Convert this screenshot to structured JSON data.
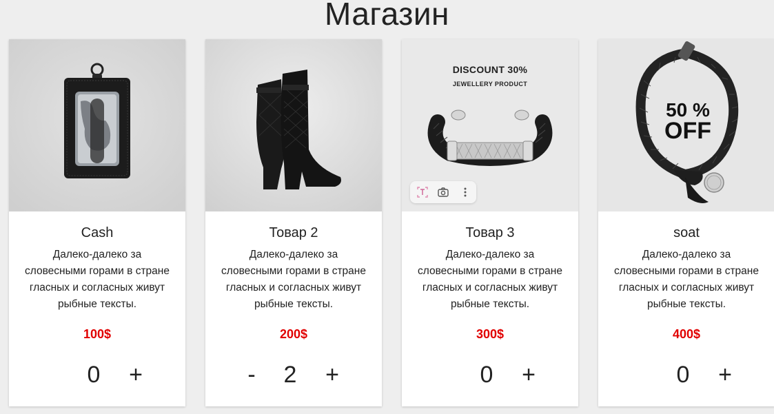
{
  "page": {
    "title": "Магазин"
  },
  "products": [
    {
      "name": "Cash",
      "description": "Далеко-далеко за словесными горами в стране гласных и согласных живут рыбные тексты.",
      "price": "100$",
      "quantity": "0",
      "minus_label": "",
      "plus_label": "+"
    },
    {
      "name": "Товар 2",
      "description": "Далеко-далеко за словесными горами в стране гласных и согласных живут рыбные тексты.",
      "price": "200$",
      "quantity": "2",
      "minus_label": "-",
      "plus_label": "+"
    },
    {
      "name": "Товар 3",
      "description": "Далеко-далеко за словесными горами в стране гласных и согласных живут рыбные тексты.",
      "price": "300$",
      "quantity": "0",
      "minus_label": "",
      "plus_label": "+",
      "image_text": {
        "headline": "DISCOUNT 30%",
        "subline": "JEWELLERY PRODUCT"
      }
    },
    {
      "name": "soat",
      "description": "Далеко-далеко за словесными горами в стране гласных и согласных живут рыбные тексты.",
      "price": "400$",
      "quantity": "0",
      "minus_label": "",
      "plus_label": "+",
      "image_text": {
        "percent": "50 %",
        "off": "OFF"
      }
    }
  ],
  "image_toolbar": {
    "icons": [
      "text-select-icon",
      "camera-search-icon",
      "more-vertical-icon"
    ]
  },
  "colors": {
    "price": "#e10000",
    "background": "#eeeeee",
    "card": "#ffffff"
  }
}
